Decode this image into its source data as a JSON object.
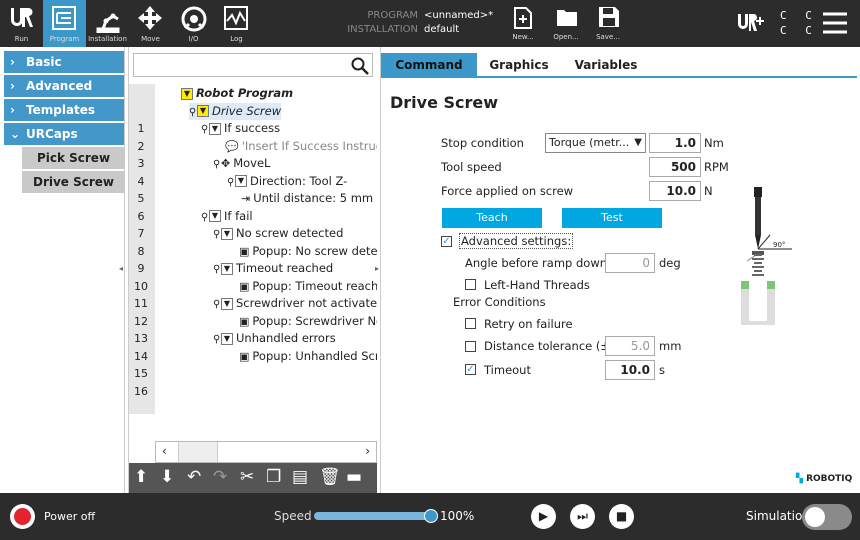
{
  "topbar": {
    "nav": [
      {
        "label": "Run",
        "icon": "ur-logo-icon"
      },
      {
        "label": "Program",
        "icon": "program-icon",
        "active": true
      },
      {
        "label": "Installation",
        "icon": "installation-icon"
      },
      {
        "label": "Move",
        "icon": "move-icon"
      },
      {
        "label": "I/O",
        "icon": "io-icon"
      },
      {
        "label": "Log",
        "icon": "log-icon"
      }
    ],
    "program_key": "PROGRAM",
    "program_value": "<unnamed>*",
    "installation_key": "INSTALLATION",
    "installation_value": "default",
    "file_buttons": [
      {
        "label": "New..."
      },
      {
        "label": "Open..."
      },
      {
        "label": "Save..."
      }
    ],
    "cc_line1": "C C",
    "cc_line2": "C C"
  },
  "sidebar": {
    "categories": [
      {
        "label": "Basic",
        "chevron": "›"
      },
      {
        "label": "Advanced",
        "chevron": "›"
      },
      {
        "label": "Templates",
        "chevron": "›"
      },
      {
        "label": "URCaps",
        "chevron": "⌄"
      }
    ],
    "subitems": [
      {
        "label": "Pick Screw"
      },
      {
        "label": "Drive Screw"
      }
    ]
  },
  "tree": {
    "line_numbers": [
      "1",
      "2",
      "3",
      "4",
      "5",
      "6",
      "7",
      "8",
      "9",
      "10",
      "11",
      "12",
      "13",
      "14",
      "15",
      "16"
    ],
    "nodes": [
      {
        "text": "Robot Program"
      },
      {
        "text": "Drive Screw"
      },
      {
        "text": "If success"
      },
      {
        "text": "'Insert If Success Instructions'"
      },
      {
        "text": "MoveL"
      },
      {
        "text": "Direction: Tool Z-"
      },
      {
        "text": "Until distance: 5 mm"
      },
      {
        "text": "If fail"
      },
      {
        "text": "No screw detected"
      },
      {
        "text": "Popup: No screw detected"
      },
      {
        "text": "Timeout reached"
      },
      {
        "text": "Popup: Timeout reached"
      },
      {
        "text": "Screwdriver not activated"
      },
      {
        "text": "Popup: Screwdriver Not Activated"
      },
      {
        "text": "Unhandled errors"
      },
      {
        "text": "Popup: Unhandled Screwdriver Error"
      }
    ]
  },
  "tabs": [
    {
      "label": "Command"
    },
    {
      "label": "Graphics"
    },
    {
      "label": "Variables"
    }
  ],
  "command": {
    "title": "Drive Screw",
    "stop_condition_label": "Stop condition",
    "stop_condition_value": "Torque (metr...",
    "stop_value": "1.0",
    "stop_unit": "Nm",
    "tool_speed_label": "Tool speed",
    "tool_speed_value": "500",
    "tool_speed_unit": "RPM",
    "force_label": "Force applied on screw",
    "force_value": "10.0",
    "force_unit": "N",
    "teach_label": "Teach",
    "test_label": "Test",
    "advanced_label": "Advanced settings:",
    "angle_label": "Angle before ramp down",
    "angle_value": "0",
    "angle_unit": "deg",
    "lefthand_label": "Left-Hand Threads",
    "error_conditions_label": "Error Conditions",
    "retry_label": "Retry on failure",
    "distance_label": "Distance tolerance (±)",
    "distance_value": "5.0",
    "distance_unit": "mm",
    "timeout_label": "Timeout",
    "timeout_value": "10.0",
    "timeout_unit": "s",
    "diagram_angle": "90°",
    "brand": "ROBOTIQ"
  },
  "bottombar": {
    "power_label": "Power off",
    "speed_label": "Speed",
    "speed_value": "100%",
    "speed_fraction": 1.0,
    "simulation_label": "Simulation"
  },
  "colors": {
    "accent": "#3b98c9",
    "button": "#00a7e1",
    "power": "#e5232d",
    "tree_marker": "#ffec00"
  }
}
